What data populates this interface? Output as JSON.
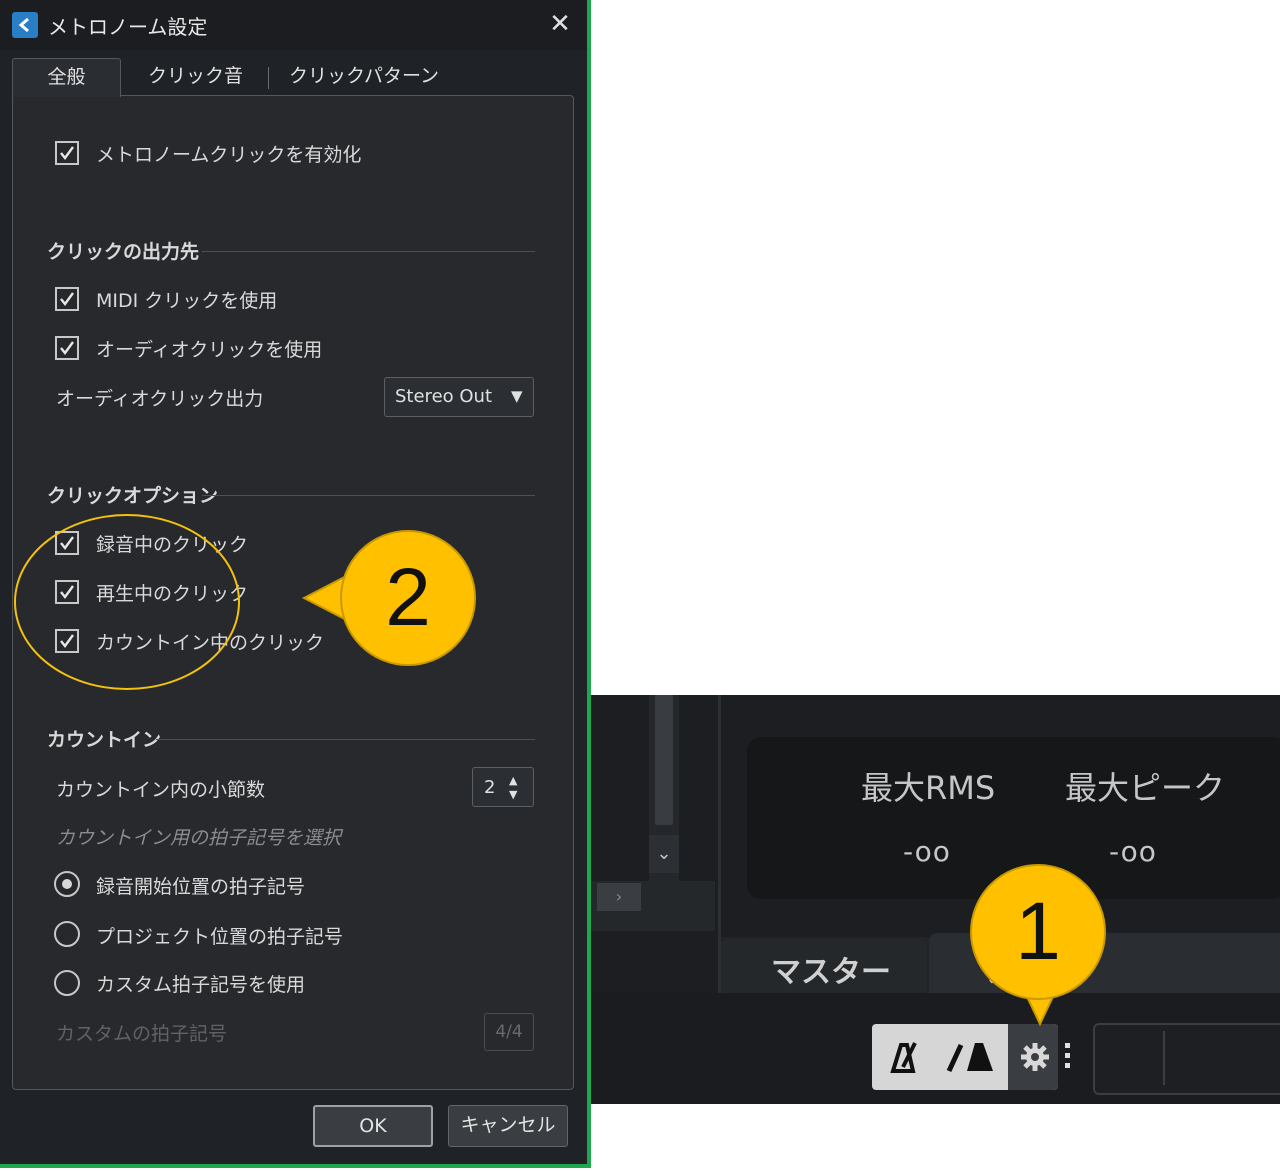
{
  "dialog": {
    "title": "メトロノーム設定",
    "close": "✕",
    "tabs": [
      {
        "label": "全般"
      },
      {
        "label": "クリック音"
      },
      {
        "label": "クリックパターン"
      }
    ],
    "enable_click": "メトロノームクリックを有効化",
    "output": {
      "title": "クリックの出力先",
      "midi": "MIDI クリックを使用",
      "audio": "オーディオクリックを使用",
      "audio_out_label": "オーディオクリック出力",
      "audio_out_value": "Stereo Out",
      "arrow": "▼"
    },
    "options": {
      "title": "クリックオプション",
      "rec": "録音中のクリック",
      "play": "再生中のクリック",
      "countin": "カウントイン中のクリック"
    },
    "countin": {
      "title": "カウントイン",
      "bars_label": "カウントイン内の小節数",
      "bars_value": "2",
      "ts_hint": "カウントイン用の拍子記号を選択",
      "radio_rec": "録音開始位置の拍子記号",
      "radio_project": "プロジェクト位置の拍子記号",
      "radio_custom": "カスタム拍子記号を使用",
      "custom_label": "カスタムの拍子記号",
      "custom_value": "4/4"
    },
    "buttons": {
      "ok": "OK",
      "cancel": "キャンセル"
    }
  },
  "transport": {
    "max_rms": "最大RMS",
    "max_peak": "最大ピーク",
    "rms_value": "-oo",
    "peak_value": "-oo",
    "tab_master": "マスター",
    "tab_other": "ス",
    "scroll_down": "⌄",
    "scroll_right": "›"
  },
  "callouts": {
    "one": "1",
    "two": "2"
  },
  "colors": {
    "accent": "#ffc000",
    "border_green": "#1ea84e",
    "dialog_bg": "#1f2226"
  }
}
